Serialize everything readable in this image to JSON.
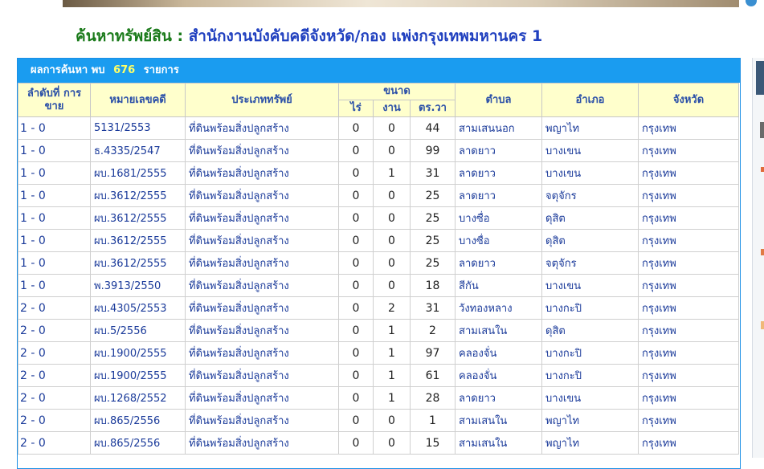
{
  "page": {
    "title_main": "ค้นหาทรัพย์สิน :",
    "title_office": "สำนักงานบังคับคดีจังหวัด/กอง  แพ่งกรุงเทพมหานคร 1"
  },
  "results": {
    "label_prefix": "ผลการค้นหา พบ",
    "count": "676",
    "label_suffix": "รายการ"
  },
  "columns": {
    "sale_order": "ลำดับที่ การขาย",
    "case_no": "หมายเลขคดี",
    "asset_type": "ประเภททรัพย์",
    "size": "ขนาด",
    "rai": "ไร่",
    "ngan": "งาน",
    "wa": "ตร.วา",
    "tambon": "ตำบล",
    "amphoe": "อำเภอ",
    "province": "จังหวัด"
  },
  "rows": [
    {
      "sale": "1 - 0",
      "case": "5131/2553",
      "type": "ที่ดินพร้อมสิ่งปลูกสร้าง",
      "rai": "0",
      "ngan": "0",
      "wa": "44",
      "tambon": "สามเสนนอก",
      "amphoe": "พญาไท",
      "province": "กรุงเทพ"
    },
    {
      "sale": "1 - 0",
      "case": "ธ.4335/2547",
      "type": "ที่ดินพร้อมสิ่งปลูกสร้าง",
      "rai": "0",
      "ngan": "0",
      "wa": "99",
      "tambon": "ลาดยาว",
      "amphoe": "บางเขน",
      "province": "กรุงเทพ"
    },
    {
      "sale": "1 - 0",
      "case": "ผบ.1681/2555",
      "type": "ที่ดินพร้อมสิ่งปลูกสร้าง",
      "rai": "0",
      "ngan": "1",
      "wa": "31",
      "tambon": "ลาดยาว",
      "amphoe": "บางเขน",
      "province": "กรุงเทพ"
    },
    {
      "sale": "1 - 0",
      "case": "ผบ.3612/2555",
      "type": "ที่ดินพร้อมสิ่งปลูกสร้าง",
      "rai": "0",
      "ngan": "0",
      "wa": "25",
      "tambon": "ลาดยาว",
      "amphoe": "จตุจักร",
      "province": "กรุงเทพ"
    },
    {
      "sale": "1 - 0",
      "case": "ผบ.3612/2555",
      "type": "ที่ดินพร้อมสิ่งปลูกสร้าง",
      "rai": "0",
      "ngan": "0",
      "wa": "25",
      "tambon": "บางซื่อ",
      "amphoe": "ดุสิต",
      "province": "กรุงเทพ"
    },
    {
      "sale": "1 - 0",
      "case": "ผบ.3612/2555",
      "type": "ที่ดินพร้อมสิ่งปลูกสร้าง",
      "rai": "0",
      "ngan": "0",
      "wa": "25",
      "tambon": "บางซื่อ",
      "amphoe": "ดุสิต",
      "province": "กรุงเทพ"
    },
    {
      "sale": "1 - 0",
      "case": "ผบ.3612/2555",
      "type": "ที่ดินพร้อมสิ่งปลูกสร้าง",
      "rai": "0",
      "ngan": "0",
      "wa": "25",
      "tambon": "ลาดยาว",
      "amphoe": "จตุจักร",
      "province": "กรุงเทพ"
    },
    {
      "sale": "1 - 0",
      "case": "พ.3913/2550",
      "type": "ที่ดินพร้อมสิ่งปลูกสร้าง",
      "rai": "0",
      "ngan": "0",
      "wa": "18",
      "tambon": "สีกัน",
      "amphoe": "บางเขน",
      "province": "กรุงเทพ"
    },
    {
      "sale": "2 - 0",
      "case": "ผบ.4305/2553",
      "type": "ที่ดินพร้อมสิ่งปลูกสร้าง",
      "rai": "0",
      "ngan": "2",
      "wa": "31",
      "tambon": "วังทองหลาง",
      "amphoe": "บางกะปิ",
      "province": "กรุงเทพ"
    },
    {
      "sale": "2 - 0",
      "case": "ผบ.5/2556",
      "type": "ที่ดินพร้อมสิ่งปลูกสร้าง",
      "rai": "0",
      "ngan": "1",
      "wa": "2",
      "tambon": "สามเสนใน",
      "amphoe": "ดุสิต",
      "province": "กรุงเทพ"
    },
    {
      "sale": "2 - 0",
      "case": "ผบ.1900/2555",
      "type": "ที่ดินพร้อมสิ่งปลูกสร้าง",
      "rai": "0",
      "ngan": "1",
      "wa": "97",
      "tambon": "คลองจั่น",
      "amphoe": "บางกะปิ",
      "province": "กรุงเทพ"
    },
    {
      "sale": "2 - 0",
      "case": "ผบ.1900/2555",
      "type": "ที่ดินพร้อมสิ่งปลูกสร้าง",
      "rai": "0",
      "ngan": "1",
      "wa": "61",
      "tambon": "คลองจั่น",
      "amphoe": "บางกะปิ",
      "province": "กรุงเทพ"
    },
    {
      "sale": "2 - 0",
      "case": "ผบ.1268/2552",
      "type": "ที่ดินพร้อมสิ่งปลูกสร้าง",
      "rai": "0",
      "ngan": "1",
      "wa": "28",
      "tambon": "ลาดยาว",
      "amphoe": "บางเขน",
      "province": "กรุงเทพ"
    },
    {
      "sale": "2 - 0",
      "case": "ผบ.865/2556",
      "type": "ที่ดินพร้อมสิ่งปลูกสร้าง",
      "rai": "0",
      "ngan": "0",
      "wa": "1",
      "tambon": "สามเสนใน",
      "amphoe": "พญาไท",
      "province": "กรุงเทพ"
    },
    {
      "sale": "2 - 0",
      "case": "ผบ.865/2556",
      "type": "ที่ดินพร้อมสิ่งปลูกสร้าง",
      "rai": "0",
      "ngan": "0",
      "wa": "15",
      "tambon": "สามเสนใน",
      "amphoe": "พญาไท",
      "province": "กรุงเทพ"
    }
  ]
}
